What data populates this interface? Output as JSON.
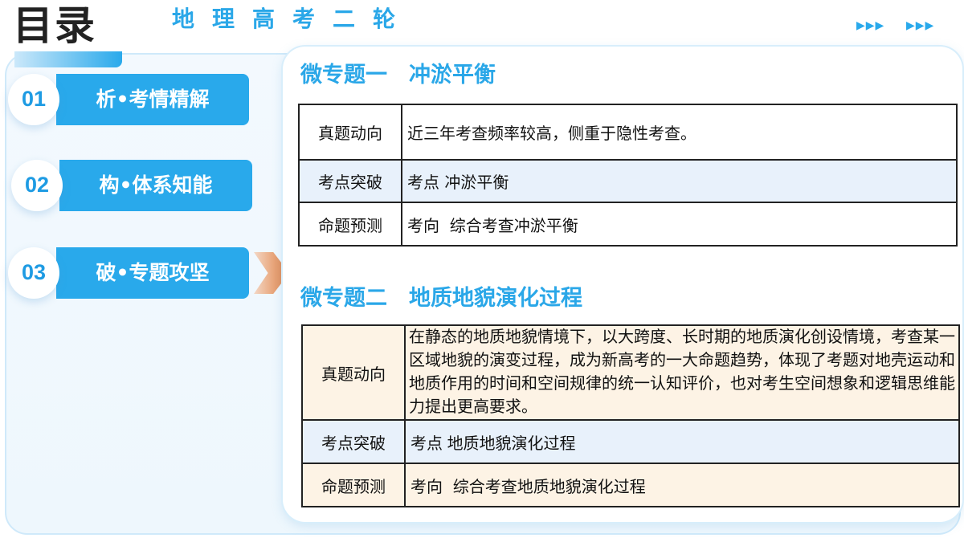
{
  "header": {
    "toc_title": "目录",
    "subject_title": "地理高考二轮",
    "arrows_left": "▶▶▶",
    "arrows_right": "▶▶▶"
  },
  "nav": [
    {
      "number": "01",
      "label": "析•考情精解",
      "active": false
    },
    {
      "number": "02",
      "label": "构•体系知能",
      "active": false
    },
    {
      "number": "03",
      "label": "破•专题攻坚",
      "active": true
    }
  ],
  "topics": [
    {
      "title": "微专题一　冲淤平衡",
      "rows": [
        {
          "label": "真题动向",
          "value": "近三年考查频率较高，侧重于隐性考查。"
        },
        {
          "label": "考点突破",
          "keyword": "考点",
          "value": "冲淤平衡"
        },
        {
          "label": "命题预测",
          "keyword": "考向",
          "value": "综合考查冲淤平衡"
        }
      ]
    },
    {
      "title": "微专题二　地质地貌演化过程",
      "rows": [
        {
          "label": "真题动向",
          "value": "在静态的地质地貌情境下，以大跨度、长时期的地质演化创设情境，考查某一区域地貌的演变过程，成为新高考的一大命题趋势，体现了考题对地壳运动和地质作用的时间和空间规律的统一认知评价，也对考生空间想象和逻辑思维能力提出更高要求。"
        },
        {
          "label": "考点突破",
          "keyword": "考点",
          "value": "地质地貌演化过程"
        },
        {
          "label": "命题预测",
          "keyword": "考向",
          "value": "综合考查地质地貌演化过程"
        }
      ]
    }
  ],
  "colors": {
    "accent": "#29a9eb",
    "title_blue": "#2aa7e8",
    "row_tint": "#e8f1fb",
    "row_beige": "#fdf3e5",
    "chevron": "#e07b3c"
  }
}
